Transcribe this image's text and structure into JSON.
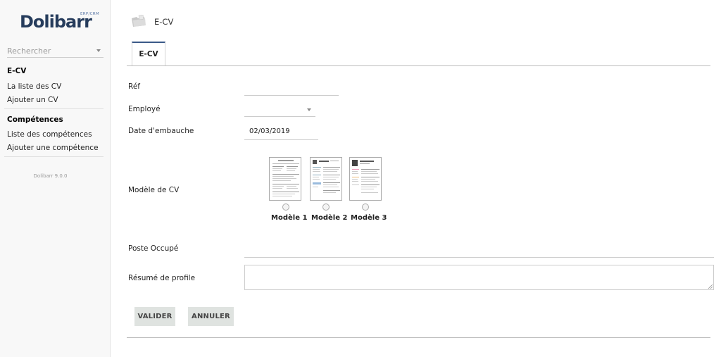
{
  "sidebar": {
    "logo": {
      "brand": "Dolibarr",
      "tag": "ERP/CRM"
    },
    "search": {
      "placeholder": "Rechercher"
    },
    "section1": {
      "title": "E-CV",
      "items": [
        "La liste des CV",
        "Ajouter un CV"
      ]
    },
    "section2": {
      "title": "Compétences",
      "items": [
        "Liste des compétences",
        "Ajouter une compétence"
      ]
    },
    "version": "Dolibarr 9.0.0"
  },
  "header": {
    "title": "E-CV",
    "icon": "folder-icon"
  },
  "tabs": [
    {
      "label": "E-CV",
      "active": true
    }
  ],
  "form": {
    "ref": {
      "label": "Réf",
      "value": ""
    },
    "employee": {
      "label": "Employé",
      "value": ""
    },
    "hire_date": {
      "label": "Date d'embauche",
      "value": "02/03/2019"
    },
    "cv_model": {
      "label": "Modèle de CV",
      "options": [
        "Modèle 1",
        "Modèle 2",
        "Modèle 3"
      ]
    },
    "position": {
      "label": "Poste Occupé",
      "value": ""
    },
    "summary": {
      "label": "Résumé de profile",
      "value": ""
    }
  },
  "buttons": {
    "submit": "VALIDER",
    "cancel": "ANNULER"
  },
  "colors": {
    "accent": "#3b5a88",
    "button_bg": "#dfe3e0",
    "logo": "#263c5c"
  }
}
